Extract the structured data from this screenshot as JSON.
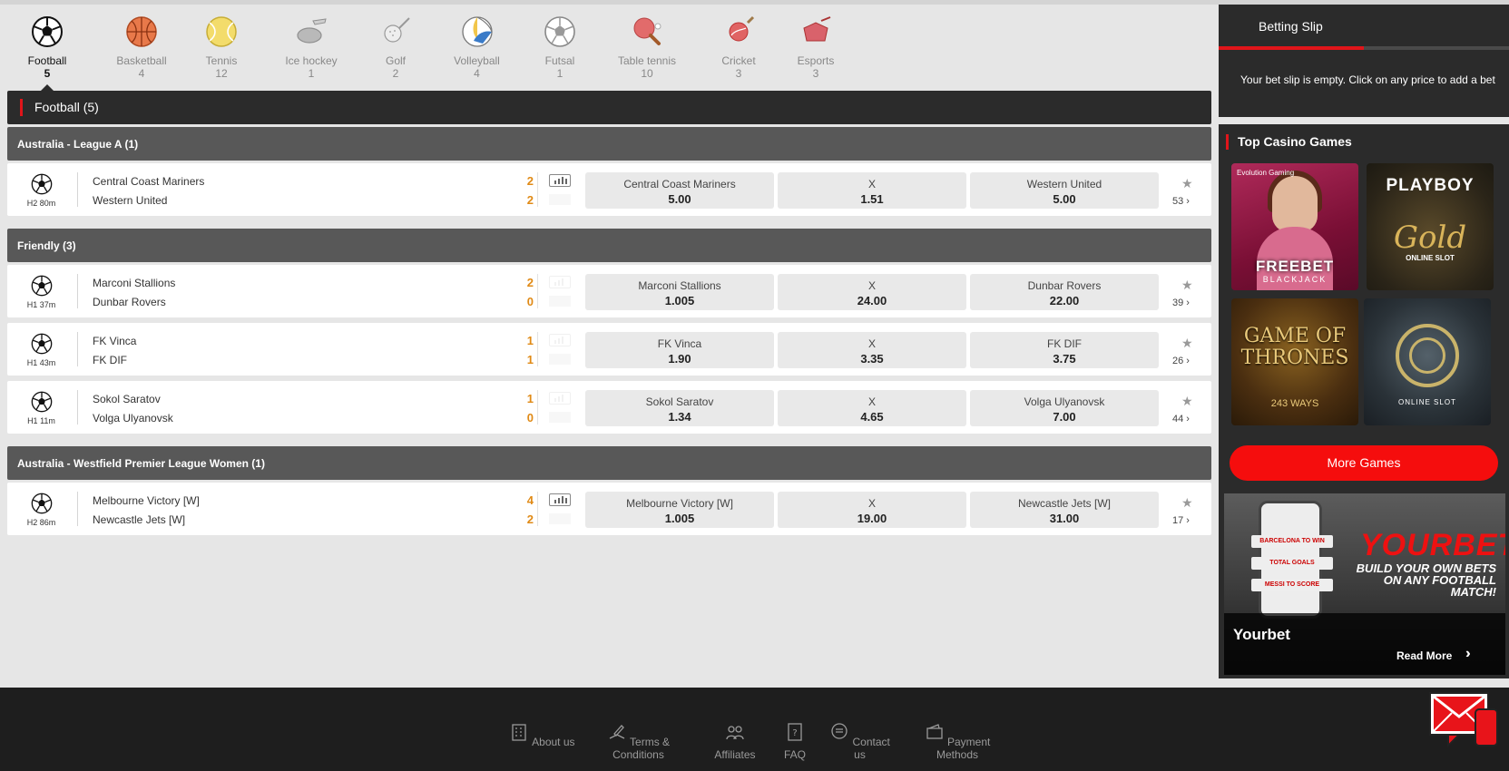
{
  "sports": [
    {
      "name": "Football",
      "count": "5",
      "active": true,
      "icon": "football-icon"
    },
    {
      "name": "Basketball",
      "count": "4",
      "icon": "basketball-icon"
    },
    {
      "name": "Tennis",
      "count": "12",
      "icon": "tennis-icon"
    },
    {
      "name": "Ice hockey",
      "count": "1",
      "icon": "ice-hockey-icon"
    },
    {
      "name": "Golf",
      "count": "2",
      "icon": "golf-icon"
    },
    {
      "name": "Volleyball",
      "count": "4",
      "icon": "volleyball-icon"
    },
    {
      "name": "Futsal",
      "count": "1",
      "icon": "futsal-icon"
    },
    {
      "name": "Table tennis",
      "count": "10",
      "icon": "table-tennis-icon"
    },
    {
      "name": "Cricket",
      "count": "3",
      "icon": "cricket-icon"
    },
    {
      "name": "Esports",
      "count": "3",
      "icon": "esports-icon"
    }
  ],
  "section": {
    "title": "Football  (5)"
  },
  "leagues": [
    {
      "name": "Australia - League A (1)"
    },
    {
      "name": "Friendly (3)"
    },
    {
      "name": "Australia - Westfield Premier League Women (1)"
    }
  ],
  "matches": [
    {
      "clock": "H2 80m",
      "home": "Central Coast Mariners",
      "away": "Western United",
      "home_score": "2",
      "away_score": "2",
      "odds": [
        {
          "name": "Central Coast Mariners",
          "value": "5.00"
        },
        {
          "name": "X",
          "value": "1.51"
        },
        {
          "name": "Western United",
          "value": "5.00"
        }
      ],
      "markets": "53 ›"
    },
    {
      "clock": "H1 37m",
      "home": "Marconi Stallions",
      "away": "Dunbar Rovers",
      "home_score": "2",
      "away_score": "0",
      "odds": [
        {
          "name": "Marconi Stallions",
          "value": "1.005"
        },
        {
          "name": "X",
          "value": "24.00"
        },
        {
          "name": "Dunbar Rovers",
          "value": "22.00"
        }
      ],
      "markets": "39 ›"
    },
    {
      "clock": "H1 43m",
      "home": "FK Vinca",
      "away": "FK DIF",
      "home_score": "1",
      "away_score": "1",
      "odds": [
        {
          "name": "FK Vinca",
          "value": "1.90"
        },
        {
          "name": "X",
          "value": "3.35"
        },
        {
          "name": "FK DIF",
          "value": "3.75"
        }
      ],
      "markets": "26 ›"
    },
    {
      "clock": "H1 11m",
      "home": "Sokol Saratov",
      "away": "Volga Ulyanovsk",
      "home_score": "1",
      "away_score": "0",
      "odds": [
        {
          "name": "Sokol Saratov",
          "value": "1.34"
        },
        {
          "name": "X",
          "value": "4.65"
        },
        {
          "name": "Volga Ulyanovsk",
          "value": "7.00"
        }
      ],
      "markets": "44 ›"
    },
    {
      "clock": "H2 86m",
      "home": "Melbourne Victory [W]",
      "away": "Newcastle Jets [W]",
      "home_score": "4",
      "away_score": "2",
      "odds": [
        {
          "name": "Melbourne Victory [W]",
          "value": "1.005"
        },
        {
          "name": "X",
          "value": "19.00"
        },
        {
          "name": "Newcastle Jets [W]",
          "value": "31.00"
        }
      ],
      "markets": "17 ›"
    }
  ],
  "betslip": {
    "title": "Betting Slip",
    "message": "Your bet slip is empty. Click on any price to add a bet"
  },
  "casino": {
    "title": "Top Casino Games",
    "games": [
      {
        "brand": "Evolution Gaming",
        "title": "FREEBET",
        "subtitle": "BLACKJACK"
      },
      {
        "title": "PLAYBOY",
        "subtitle": "Gold",
        "tag": "ONLINE SLOT"
      },
      {
        "title": "GAME OF THRONES",
        "tag": "243 WAYS"
      },
      {
        "tag": "ONLINE SLOT"
      }
    ],
    "more_label": "More Games"
  },
  "promo": {
    "pills": [
      "BARCELONA TO WIN",
      "TOTAL GOALS",
      "MESSI TO SCORE"
    ],
    "brand": "YOURBET",
    "tagline": "BUILD YOUR OWN BETS ON ANY FOOTBALL MATCH!",
    "title": "Yourbet",
    "read_more": "Read More"
  },
  "footer": [
    {
      "label": "About us",
      "icon": "building-icon"
    },
    {
      "label": "Terms & Conditions",
      "icon": "pen-paper-icon"
    },
    {
      "label": "Affiliates",
      "icon": "people-icon"
    },
    {
      "label": "FAQ",
      "icon": "question-doc-icon"
    },
    {
      "label": "Contact us",
      "icon": "chat-bubble-icon"
    },
    {
      "label": "Payment Methods",
      "icon": "wallet-icon"
    }
  ],
  "colors": {
    "accent": "#e0151a",
    "score": "#e08a16",
    "dark": "#2b2b2b",
    "league": "#585858",
    "button": "#f50d0d"
  }
}
